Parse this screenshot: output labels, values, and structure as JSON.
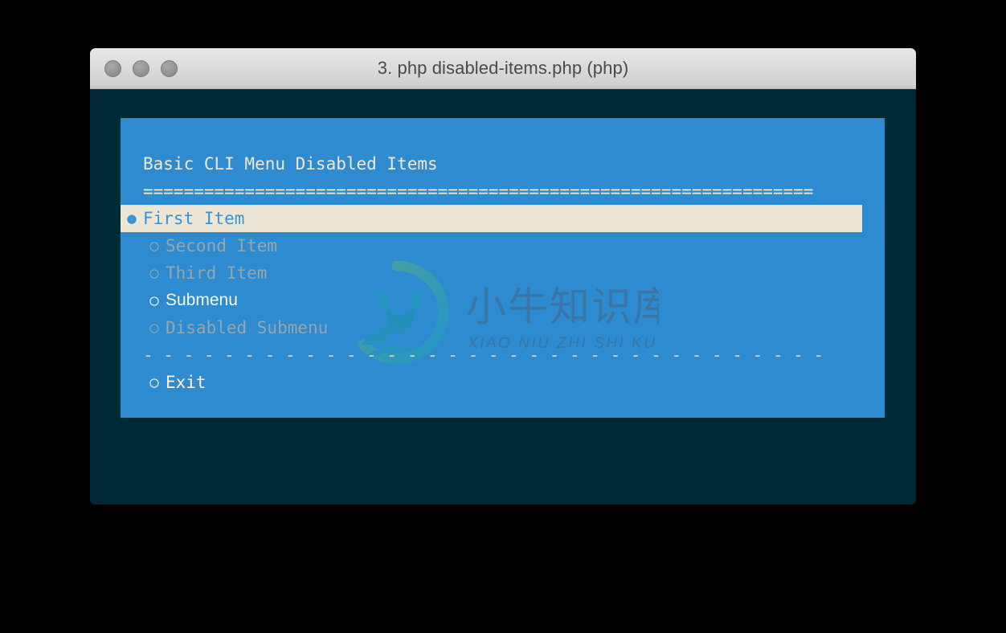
{
  "window": {
    "title": "3. php disabled-items.php (php)",
    "traffic_lights": [
      {
        "name": "close",
        "color": "#959595"
      },
      {
        "name": "minimize",
        "color": "#959595"
      },
      {
        "name": "zoom",
        "color": "#959595"
      }
    ]
  },
  "terminal": {
    "background_color": "#002B36"
  },
  "menu": {
    "background_color": "#2E8BD0",
    "title": "Basic CLI Menu Disabled Items",
    "rule_top": "==================================================================",
    "rule_bottom": "- - - - - - - - - - - - - - - - - - - - - - - - - - - - - - - - - -",
    "selected_row_color": "#EDE6D5",
    "selected_text_color": "#3A93D4",
    "enabled_text_color": "#FDF6E3",
    "disabled_text_color": "#93A8AE",
    "marker_selected": "●",
    "marker_unselected": "○",
    "items": [
      {
        "label": "First Item",
        "state": "selected",
        "marker": "●",
        "font": "mono"
      },
      {
        "label": "Second Item",
        "state": "disabled",
        "marker": "○",
        "font": "mono"
      },
      {
        "label": "Third Item",
        "state": "disabled",
        "marker": "○",
        "font": "mono"
      },
      {
        "label": "Submenu",
        "state": "enabled",
        "marker": "○",
        "font": "prop"
      },
      {
        "label": "Disabled Submenu",
        "state": "disabled",
        "marker": "○",
        "font": "mono"
      }
    ],
    "exit_item": {
      "label": "Exit",
      "state": "enabled",
      "marker": "○",
      "font": "mono"
    }
  },
  "watermark": {
    "chinese_text": "小牛知识库",
    "pinyin_text": "XIAO NIU ZHI SHI KU",
    "logo_name": "bull-head-circle-logo",
    "gradient_from": "#7DBF5A",
    "gradient_to": "#17A2B8",
    "text_color": "#4A5A66"
  }
}
